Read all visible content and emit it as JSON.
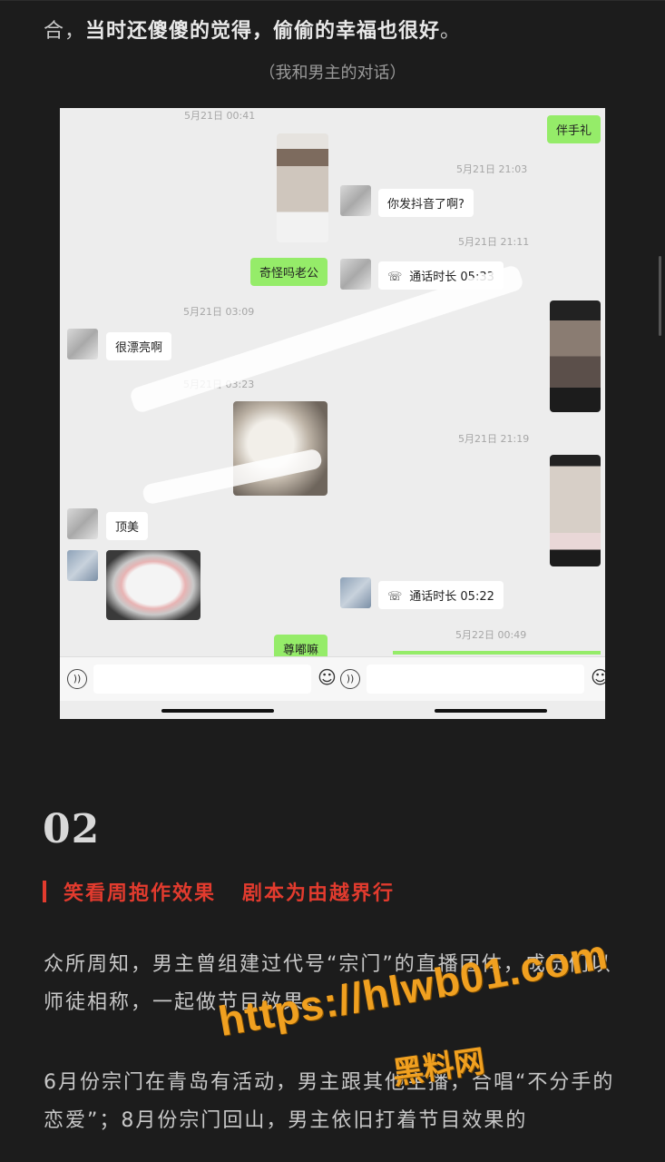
{
  "intro": {
    "plain": "合，",
    "bold": "当时还傻傻的觉得，偷偷的幸福也很好",
    "end": "。"
  },
  "caption": "（我和男主的对话）",
  "chat": {
    "timestamps": [
      "5月21日 00:41",
      "5月21日 21:03",
      "5月21日 21:11",
      "5月21日 03:09",
      "5月21日 03:23",
      "5月21日 21:19",
      "5月22日 00:49"
    ],
    "bubbles": {
      "gift": "伴手礼",
      "douyin": "你发抖音了啊?",
      "weird": "奇怪吗老公",
      "call1": "通话时长 05:33",
      "pretty": "很漂亮啊",
      "top": "顶美",
      "call2": "通话时长 05:22",
      "zundu": "尊嘟嘛"
    },
    "icons": {
      "call": "phone-icon",
      "voice": "voice-icon",
      "emoji": "emoji-icon"
    }
  },
  "section": {
    "number": "02",
    "title": "笑看周抱作效果   剧本为由越界行"
  },
  "paragraphs": [
    "众所周知，男主曾组建过代号“宗门”的直播团体，成员们以师徒相称，一起做节目效果。",
    "6月份宗门在青岛有活动，男主跟其他主播，合唱“不分手的恋爱”；8月份宗门回山，男主依旧打着节目效果的"
  ],
  "watermark": {
    "url": "https://hlwb01.com",
    "name": "黑料网"
  },
  "colors": {
    "accent": "#e23b2e",
    "watermark": "#f0a020",
    "green_bubble": "#95ec69"
  }
}
